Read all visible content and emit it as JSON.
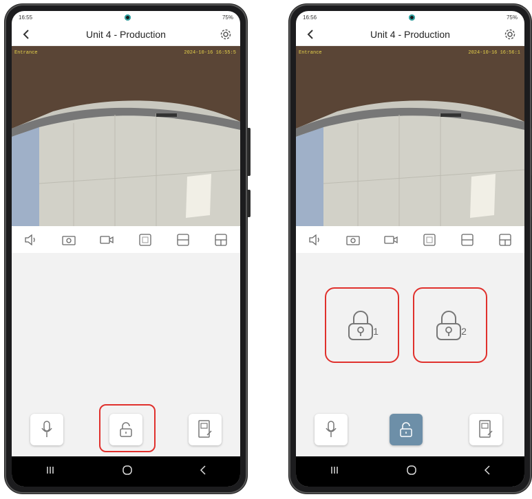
{
  "left": {
    "status_time": "16:55",
    "status_right": "75%",
    "title": "Unit 4 - Production",
    "video_timestamp": "2024-10-16 16:55:5",
    "video_channel": "Entrance"
  },
  "right": {
    "status_time": "16:56",
    "status_right": "75%",
    "title": "Unit 4 - Production",
    "video_timestamp": "2024-10-16 16:56:1",
    "video_channel": "Entrance",
    "unlock_buttons": [
      {
        "number": "1"
      },
      {
        "number": "2"
      }
    ]
  },
  "icons": {
    "back": "chevron-left",
    "settings": "gear",
    "toolbar": [
      "speaker",
      "snapshot",
      "record",
      "layout-1",
      "layout-2",
      "layout-3"
    ],
    "bottom": [
      "microphone",
      "unlock",
      "intercom-panel"
    ],
    "nav": [
      "recents",
      "home",
      "back"
    ]
  },
  "colors": {
    "highlight": "#e0302c",
    "active_unlock": "#6d8fa8",
    "content_bg": "#f2f2f2"
  }
}
